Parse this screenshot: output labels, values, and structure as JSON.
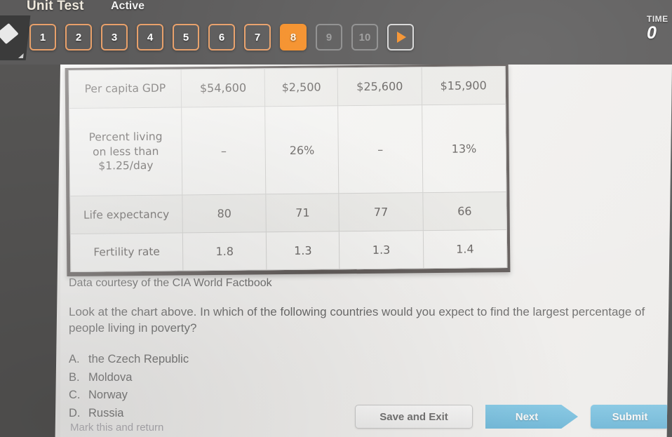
{
  "topbar": {
    "unit_test_label": "Unit Test",
    "status_label": "Active",
    "back_icon": "back-arrow-icon",
    "question_buttons": [
      {
        "label": "1",
        "state": "available"
      },
      {
        "label": "2",
        "state": "available"
      },
      {
        "label": "3",
        "state": "available"
      },
      {
        "label": "4",
        "state": "available"
      },
      {
        "label": "5",
        "state": "available"
      },
      {
        "label": "6",
        "state": "available"
      },
      {
        "label": "7",
        "state": "available"
      },
      {
        "label": "8",
        "state": "current"
      },
      {
        "label": "9",
        "state": "disabled"
      },
      {
        "label": "10",
        "state": "disabled"
      }
    ],
    "next_arrow_icon": "play-triangle-icon",
    "timer": {
      "label": "TIME",
      "value": "0"
    },
    "accent_color": "#f5902a",
    "bar_color": "#5c5b5b"
  },
  "figure": {
    "caption": "Data courtesy of the CIA World Factbook"
  },
  "chart_data": {
    "type": "table",
    "title": "",
    "caption": "Data courtesy of the CIA World Factbook",
    "row_labels": [
      "Per capita GDP",
      "Percent living on less than $1.25/day",
      "Life expectancy",
      "Fertility rate"
    ],
    "columns": 4,
    "rows": [
      {
        "label": "Per capita GDP",
        "values": [
          "$54,600",
          "$2,500",
          "$25,600",
          "$15,900"
        ]
      },
      {
        "label": "Percent living on less than $1.25/day",
        "values": [
          "–",
          "26%",
          "–",
          "13%"
        ]
      },
      {
        "label": "Life expectancy",
        "values": [
          "80",
          "71",
          "77",
          "66"
        ]
      },
      {
        "label": "Fertility rate",
        "values": [
          "1.8",
          "1.3",
          "1.3",
          "1.4"
        ]
      }
    ],
    "row2_line1": "Percent living",
    "row2_line2": "on less than",
    "row2_line3": "$1.25/day"
  },
  "question": {
    "text": "Look at the chart above. In which of the following countries would you expect to find the largest percentage of people living in poverty?",
    "choices": [
      {
        "letter": "A.",
        "text": "the Czech Republic"
      },
      {
        "letter": "B.",
        "text": "Moldova"
      },
      {
        "letter": "C.",
        "text": "Norway"
      },
      {
        "letter": "D.",
        "text": "Russia"
      }
    ],
    "mark_and_return": "Mark this and return"
  },
  "actions": {
    "save_exit_label": "Save and Exit",
    "next_label": "Next",
    "submit_label": "Submit",
    "primary_color": "#46a9d8"
  }
}
